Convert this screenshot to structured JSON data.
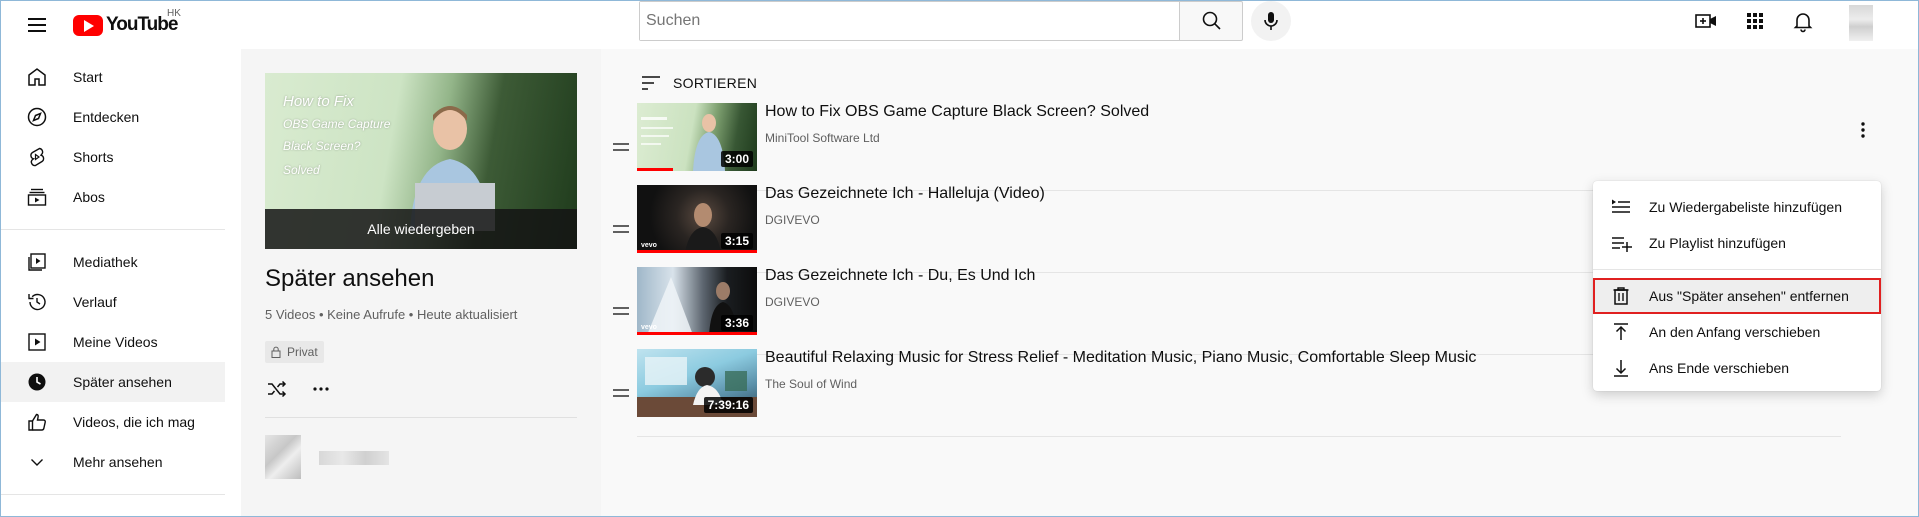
{
  "header": {
    "logo_text": "YouTube",
    "region": "HK",
    "search_placeholder": "Suchen"
  },
  "sidebar": {
    "items": [
      {
        "label": "Start",
        "icon": "home-icon"
      },
      {
        "label": "Entdecken",
        "icon": "compass-icon"
      },
      {
        "label": "Shorts",
        "icon": "shorts-icon"
      },
      {
        "label": "Abos",
        "icon": "subscriptions-icon"
      }
    ],
    "library": [
      {
        "label": "Mediathek",
        "icon": "library-icon"
      },
      {
        "label": "Verlauf",
        "icon": "history-icon"
      },
      {
        "label": "Meine Videos",
        "icon": "my-videos-icon"
      },
      {
        "label": "Später ansehen",
        "icon": "clock-icon",
        "active": true
      },
      {
        "label": "Videos, die ich mag",
        "icon": "thumbs-up-icon"
      },
      {
        "label": "Mehr ansehen",
        "icon": "chevron-down-icon"
      }
    ]
  },
  "playlist": {
    "thumb_lines": [
      "How to Fix",
      "OBS Game Capture",
      "Black Screen?",
      "Solved"
    ],
    "play_all": "Alle wiedergeben",
    "title": "Später ansehen",
    "meta": "5 Videos • Keine Aufrufe • Heute aktualisiert",
    "privacy": "Privat"
  },
  "list": {
    "sort_label": "SORTIEREN",
    "videos": [
      {
        "title": "How to Fix OBS Game Capture Black Screen? Solved",
        "channel": "MiniTool Software Ltd",
        "duration": "3:00"
      },
      {
        "title": "Das Gezeichnete Ich - Halleluja (Video)",
        "channel": "DGIVEVO",
        "duration": "3:15"
      },
      {
        "title": "Das Gezeichnete Ich - Du, Es Und Ich",
        "channel": "DGIVEVO",
        "duration": "3:36"
      },
      {
        "title": "Beautiful Relaxing Music for Stress Relief - Meditation Music, Piano Music, Comfortable Sleep Music",
        "channel": "The Soul of Wind",
        "duration": "7:39:16"
      }
    ]
  },
  "menu": {
    "items": [
      {
        "label": "Zu Wiedergabeliste hinzufügen",
        "icon": "queue-icon"
      },
      {
        "label": "Zu Playlist hinzufügen",
        "icon": "playlist-add-icon"
      },
      {
        "label": "Aus \"Später ansehen\" entfernen",
        "icon": "trash-icon",
        "highlighted": true
      },
      {
        "label": "An den Anfang verschieben",
        "icon": "move-to-top-icon"
      },
      {
        "label": "Ans Ende verschieben",
        "icon": "move-to-bottom-icon"
      }
    ]
  },
  "colors": {
    "accent": "#ff0000",
    "highlight_border": "#e02020"
  }
}
